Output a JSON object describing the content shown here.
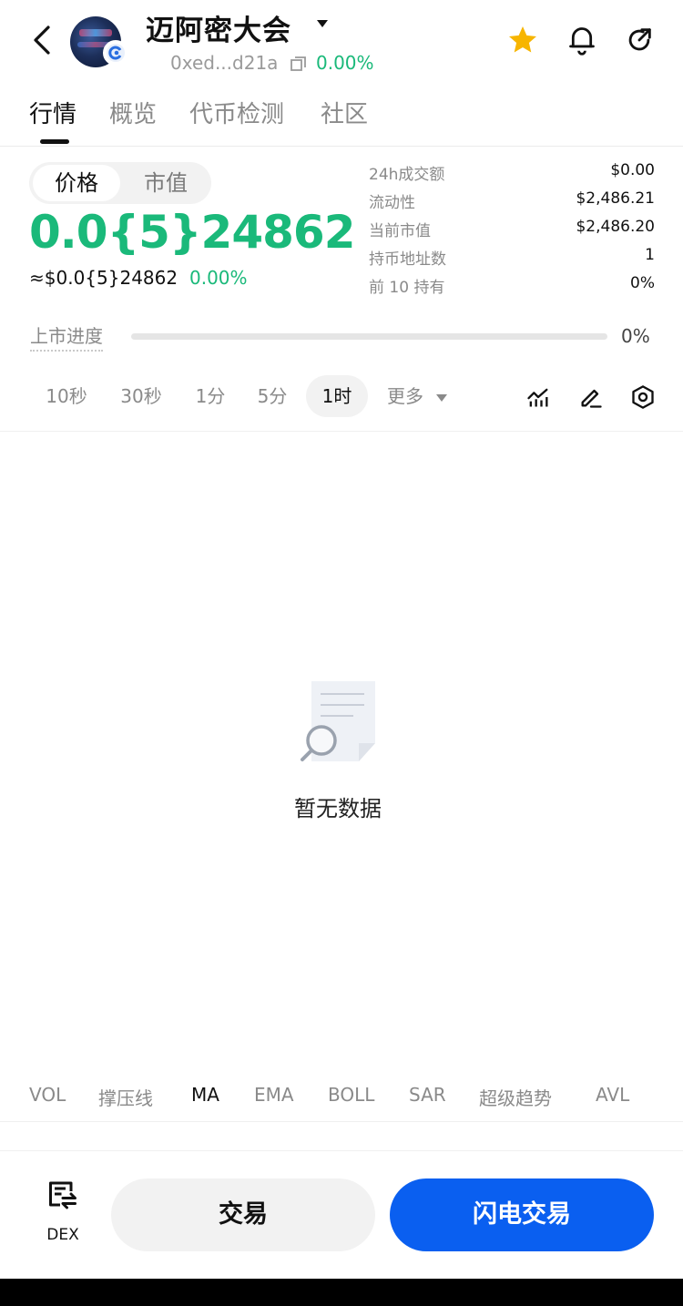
{
  "header": {
    "token_name": "迈阿密大会",
    "address": "0xed...d21a",
    "change": "0.00%",
    "icons": [
      "back-icon",
      "chain-icon",
      "caret-down-icon",
      "copy-icon",
      "star-icon",
      "bell-icon",
      "share-icon"
    ]
  },
  "tabs": [
    {
      "label": "行情",
      "active": true
    },
    {
      "label": "概览",
      "active": false
    },
    {
      "label": "代币检测",
      "active": false
    },
    {
      "label": "社区",
      "active": false
    }
  ],
  "segment": {
    "price": "价格",
    "market_cap": "市值",
    "selected": "价格"
  },
  "price": {
    "big": "0.0{5}24862",
    "usd": "≈$0.0{5}24862",
    "change": "0.00%"
  },
  "stats": [
    {
      "label": "24h成交额",
      "value": "$0.00"
    },
    {
      "label": "流动性",
      "value": "$2,486.21"
    },
    {
      "label": "当前市值",
      "value": "$2,486.20"
    },
    {
      "label": "持币地址数",
      "value": "1"
    },
    {
      "label": "前 10 持有",
      "value": "0%"
    }
  ],
  "progress": {
    "label": "上市进度",
    "value_text": "0%",
    "fraction": 0
  },
  "timeframes": [
    "10秒",
    "30秒",
    "1分",
    "5分",
    "1时",
    "更多"
  ],
  "selected_timeframe": "1时",
  "tools": [
    "indicator-icon",
    "draw-icon",
    "settings-icon"
  ],
  "empty": {
    "text": "暂无数据"
  },
  "indicators": [
    "VOL",
    "撑压线",
    "MA",
    "EMA",
    "BOLL",
    "SAR",
    "超级趋势",
    "AVL"
  ],
  "active_indicator": "MA",
  "bottom": {
    "dex": "DEX",
    "trade": "交易",
    "flash_trade": "闪电交易"
  },
  "colors": {
    "green": "#1ab97a",
    "blue": "#0a5ff0",
    "star": "#f7b500"
  }
}
